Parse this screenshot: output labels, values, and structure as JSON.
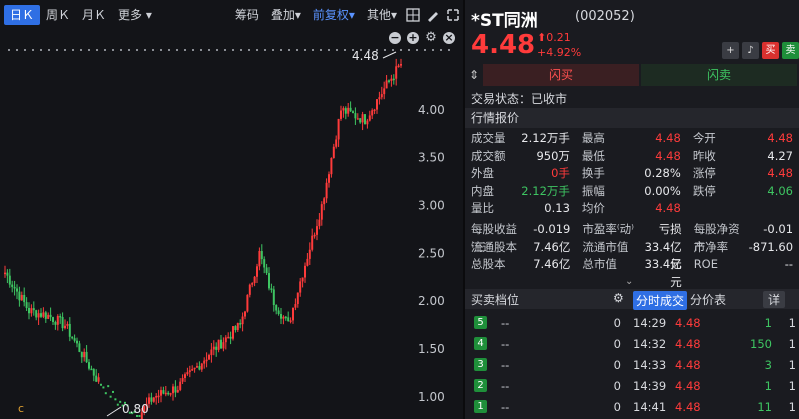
{
  "toolbar": {
    "tabs": [
      "日Ｋ",
      "周Ｋ",
      "月Ｋ",
      "更多"
    ],
    "right": [
      "筹码",
      "叠加",
      "前复权",
      "其他"
    ]
  },
  "chart_data": {
    "type": "candlestick",
    "ymin": 0.8,
    "ymax": 4.48,
    "yticks": [
      "4.00",
      "3.50",
      "3.00",
      "2.50",
      "2.00",
      "1.50",
      "1.00"
    ],
    "high_label": "4.48",
    "low_label": "0.80",
    "marker_c": "c"
  },
  "stock": {
    "name": "*ST同洲",
    "code": "(002052)",
    "price": "4.48",
    "change": "0.21",
    "change_pct": "+4.92%",
    "status": "交易状态：已收市"
  },
  "actions": {
    "add": "+",
    "alert": "🔔",
    "buy": "买",
    "sell": "卖"
  },
  "flash": {
    "buy": "闪买",
    "sell": "闪卖"
  },
  "quote_title": "行情报价",
  "quote": [
    [
      {
        "l": "成交量"
      },
      {
        "v": "2.12万手"
      },
      {
        "l": "最高"
      },
      {
        "v": "4.48",
        "c": "red"
      },
      {
        "l": "今开"
      },
      {
        "v": "4.48",
        "c": "red"
      }
    ],
    [
      {
        "l": "成交额"
      },
      {
        "v": "950万"
      },
      {
        "l": "最低"
      },
      {
        "v": "4.48",
        "c": "red"
      },
      {
        "l": "昨收"
      },
      {
        "v": "4.27"
      }
    ],
    [
      {
        "l": "外盘"
      },
      {
        "v": "0手",
        "c": "red"
      },
      {
        "l": "换手"
      },
      {
        "v": "0.28%"
      },
      {
        "l": "涨停"
      },
      {
        "v": "4.48",
        "c": "red"
      }
    ],
    [
      {
        "l": "内盘"
      },
      {
        "v": "2.12万手",
        "c": "green"
      },
      {
        "l": "振幅"
      },
      {
        "v": "0.00%"
      },
      {
        "l": "跌停"
      },
      {
        "v": "4.06",
        "c": "green"
      }
    ],
    [
      {
        "l": "量比"
      },
      {
        "v": "0.13"
      },
      {
        "l": "均价"
      },
      {
        "v": "4.48",
        "c": "red"
      },
      {
        "l": ""
      },
      {
        "v": ""
      }
    ]
  ],
  "quote2": [
    [
      {
        "l": "每股收益⁽三⁾"
      },
      {
        "v": "-0.019"
      },
      {
        "l": "市盈率⁽动⁾"
      },
      {
        "v": "亏损"
      },
      {
        "l": "每股净资产"
      },
      {
        "v": "-0.01"
      }
    ],
    [
      {
        "l": "流通股本"
      },
      {
        "v": "7.46亿"
      },
      {
        "l": "流通市值"
      },
      {
        "v": "33.4亿元"
      },
      {
        "l": "市净率"
      },
      {
        "v": "-871.60"
      }
    ],
    [
      {
        "l": "总股本"
      },
      {
        "v": "7.46亿"
      },
      {
        "l": "总市值"
      },
      {
        "v": "33.4亿元"
      },
      {
        "l": "ROE"
      },
      {
        "v": "--"
      }
    ]
  ],
  "bottom": {
    "orderbook": "买卖档位",
    "tab1": "分时成交",
    "tab2": "分价表",
    "detail": "详"
  },
  "orderbook": [
    {
      "lvl": "5",
      "price": "--",
      "qty": "0"
    },
    {
      "lvl": "4",
      "price": "--",
      "qty": "0"
    },
    {
      "lvl": "3",
      "price": "--",
      "qty": "0"
    },
    {
      "lvl": "2",
      "price": "--",
      "qty": "0"
    },
    {
      "lvl": "1",
      "price": "--",
      "qty": "0"
    }
  ],
  "ticks": [
    {
      "t": "14:29",
      "p": "4.48",
      "v": "1",
      "n": "1"
    },
    {
      "t": "14:32",
      "p": "4.48",
      "v": "150",
      "n": "1"
    },
    {
      "t": "14:33",
      "p": "4.48",
      "v": "3",
      "n": "1"
    },
    {
      "t": "14:39",
      "p": "4.48",
      "v": "1",
      "n": "1"
    },
    {
      "t": "14:41",
      "p": "4.48",
      "v": "11",
      "n": "1"
    }
  ]
}
